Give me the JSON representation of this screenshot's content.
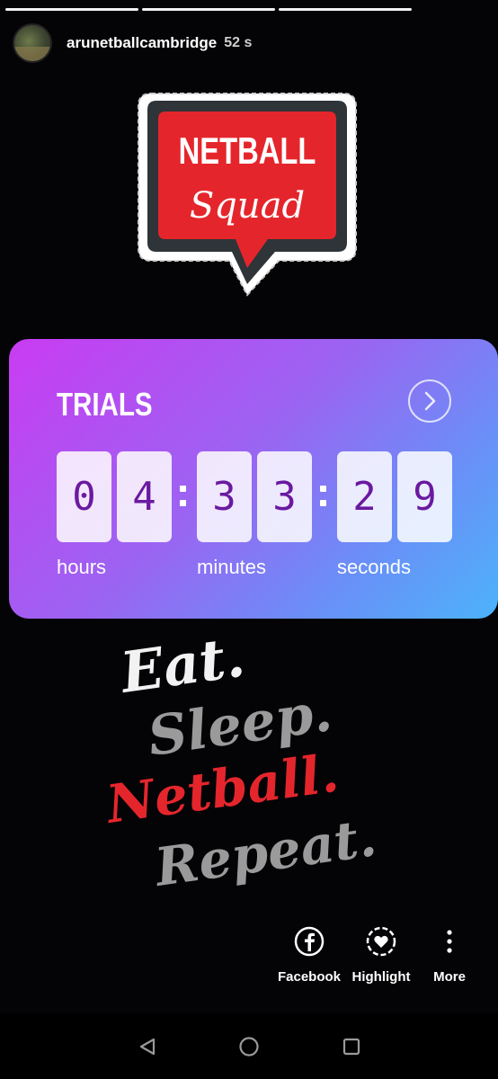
{
  "story": {
    "username": "arunetballcambridge",
    "time_ago": "52 s",
    "progress_segments": 3
  },
  "sticker": {
    "line1": "NETBALL",
    "line2": "Squad",
    "colors": {
      "red": "#e4262c",
      "dark": "#2e3438",
      "white": "#ffffff"
    }
  },
  "countdown": {
    "title": "TRIALS",
    "hours": [
      "0",
      "4"
    ],
    "minutes": [
      "3",
      "3"
    ],
    "seconds": [
      "2",
      "9"
    ],
    "units": {
      "hours": "hours",
      "minutes": "minutes",
      "seconds": "seconds"
    },
    "digit_color": "#6a1aa0"
  },
  "slogan": {
    "line1": "Eat.",
    "line2": "Sleep.",
    "line3": "Netball.",
    "line4": "Repeat.",
    "colors": {
      "eat": "#f2f2f2",
      "sleep": "#9a9a9a",
      "netball": "#e4262c",
      "repeat": "#9a9a9a"
    }
  },
  "share": {
    "facebook": "Facebook",
    "highlight": "Highlight",
    "more": "More"
  },
  "navbar": {
    "icons": [
      "back-icon",
      "home-icon",
      "recents-icon"
    ]
  }
}
